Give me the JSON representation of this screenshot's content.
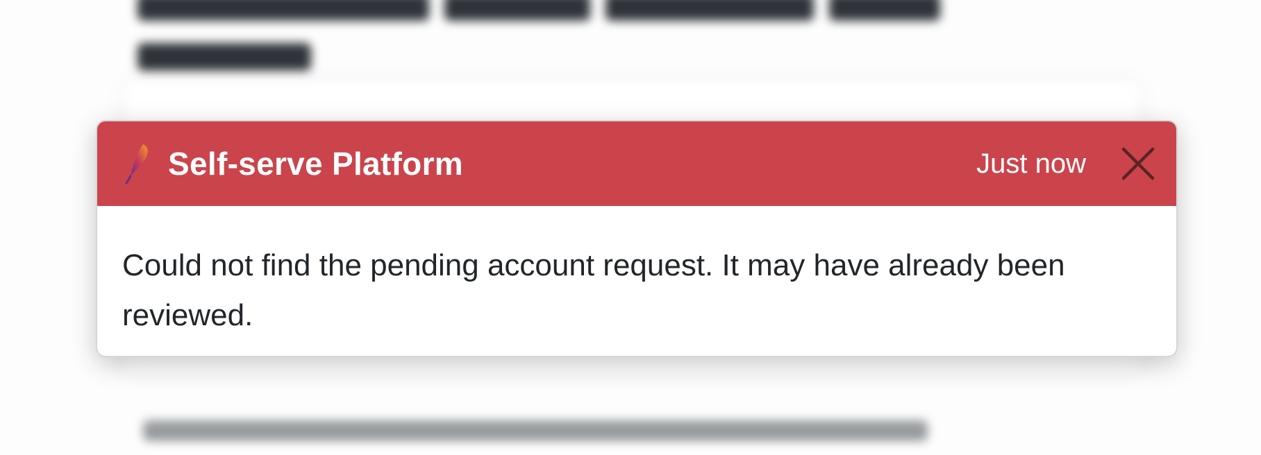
{
  "toast": {
    "app_name": "Self-serve Platform",
    "timestamp": "Just now",
    "message": "Could not find the pending account request. It may have already been reviewed.",
    "icons": {
      "app": "feather-icon",
      "close": "close-icon"
    },
    "colors": {
      "header_bg": "#cb444b",
      "header_text": "#ffffff",
      "body_text": "#22262a"
    }
  }
}
